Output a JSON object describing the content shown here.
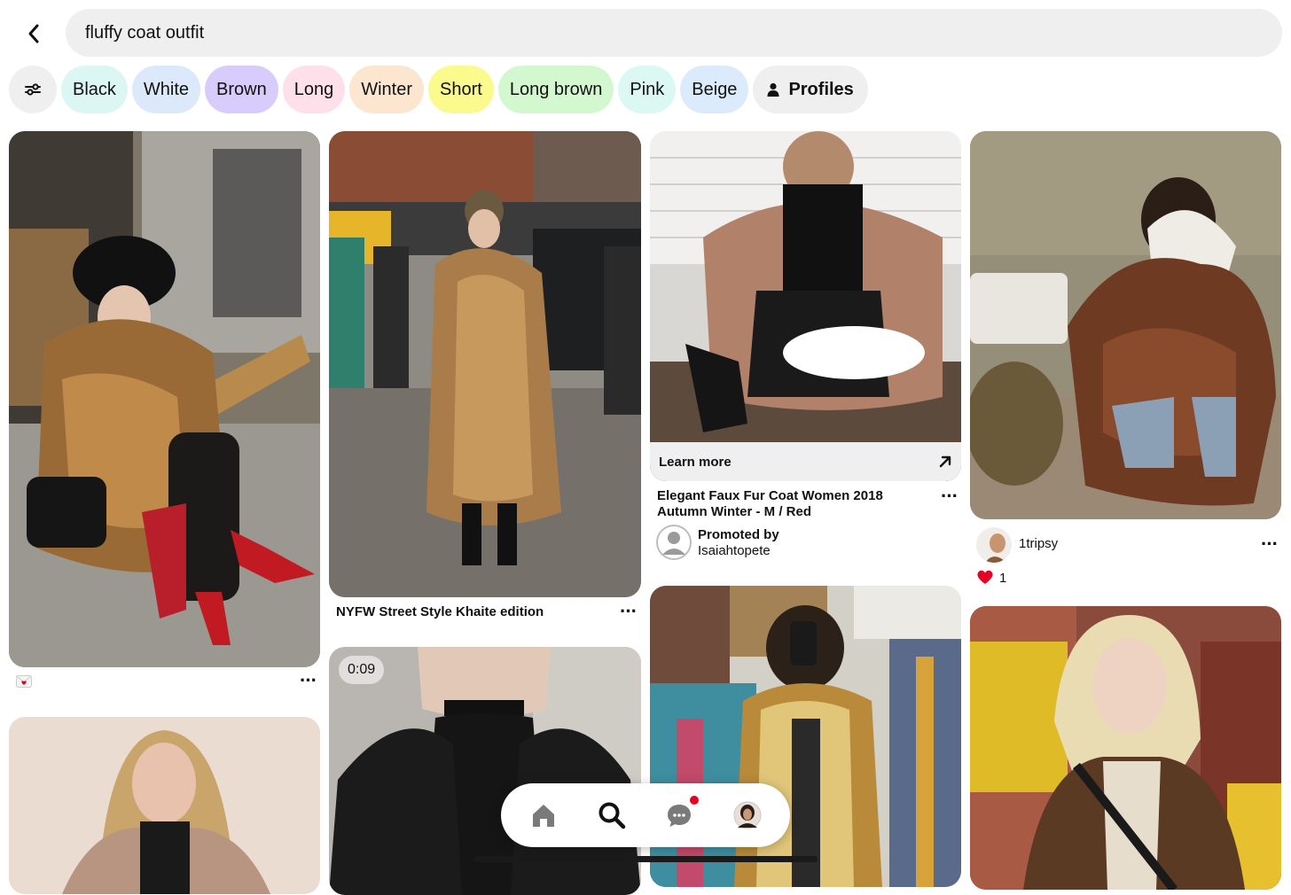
{
  "search": {
    "query": "fluffy coat outfit"
  },
  "chips": [
    {
      "label": "Black",
      "color": "#dcf7f3"
    },
    {
      "label": "White",
      "color": "#dce9fb"
    },
    {
      "label": "Brown",
      "color": "#d7ccfb"
    },
    {
      "label": "Long",
      "color": "#fde0ea"
    },
    {
      "label": "Winter",
      "color": "#fde6cf"
    },
    {
      "label": "Short",
      "color": "#fbfa8c"
    },
    {
      "label": "Long brown",
      "color": "#d3f7cf"
    },
    {
      "label": "Pink",
      "color": "#dcf8f3"
    },
    {
      "label": "Beige",
      "color": "#dcebfb"
    }
  ],
  "profiles_chip": {
    "label": "Profiles"
  },
  "pins": {
    "pin1": {
      "caption_icon": "love-letter-emoji"
    },
    "pin2": {
      "title": "NYFW Street Style Khaite edition"
    },
    "pin3": {
      "learn_more": "Learn more",
      "title": "Elegant Faux Fur Coat Women 2018 Autumn Winter - M / Red",
      "promoted_label": "Promoted by",
      "promoter": "Isaiahtopete"
    },
    "pin4": {
      "username": "1tripsy",
      "reaction_count": "1"
    },
    "pin6": {
      "duration": "0:09"
    }
  },
  "nav": {
    "items": [
      "home",
      "search",
      "messages",
      "profile"
    ],
    "messages_badge": true
  },
  "colors": {
    "accent_red": "#e60023",
    "chip_gray": "#efefef"
  }
}
